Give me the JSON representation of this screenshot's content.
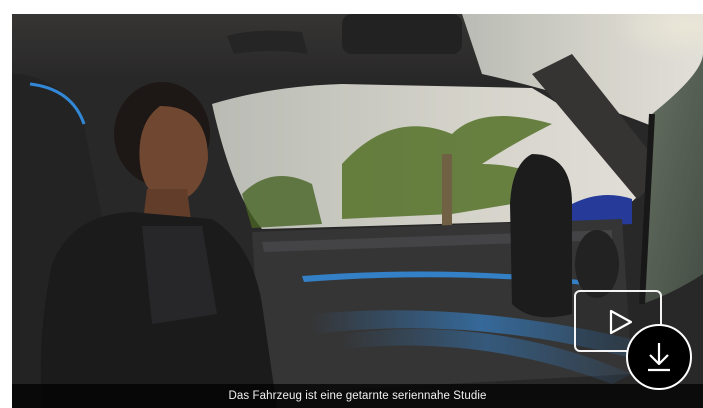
{
  "video": {
    "caption": "Das Fahrzeug ist eine getarnte seriennahe Studie"
  },
  "controls": {
    "play_icon": "play-icon",
    "download_icon": "download-icon"
  },
  "colors": {
    "accent_blue": "#3aa0ff",
    "caption_bg": "#000000",
    "button_border": "#ffffff"
  }
}
